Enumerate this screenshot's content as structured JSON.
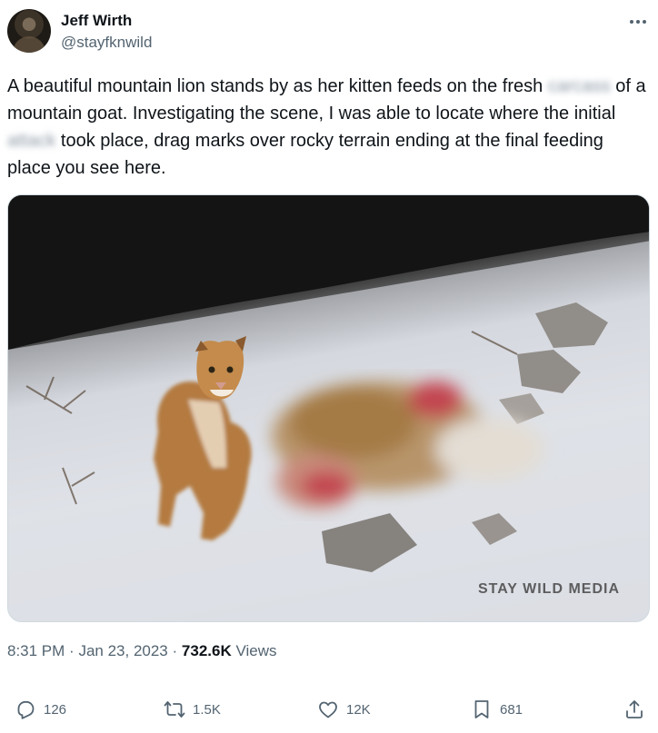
{
  "author": {
    "name": "Jeff Wirth",
    "handle": "@stayfknwild"
  },
  "tweet": {
    "segments": [
      {
        "text": "A beautiful mountain lion stands by as her kitten feeds on the fresh ",
        "blurred": false
      },
      {
        "text": "carcass",
        "blurred": true
      },
      {
        "text": " of a mountain goat. Investigating the scene, I was able to locate where the initial ",
        "blurred": false
      },
      {
        "text": "attack",
        "blurred": true
      },
      {
        "text": " took place, drag marks over rocky terrain ending at the final feeding place you see here.",
        "blurred": false
      }
    ]
  },
  "media": {
    "watermark": "STAY WILD MEDIA"
  },
  "meta": {
    "time": "8:31 PM",
    "separator": "·",
    "date": "Jan 23, 2023",
    "views_count": "732.6K",
    "views_label": "Views"
  },
  "actions": {
    "replies": "126",
    "reposts": "1.5K",
    "likes": "12K",
    "bookmarks": "681"
  },
  "icons": {
    "more": "more-icon",
    "reply": "reply-icon",
    "repost": "repost-icon",
    "like": "heart-icon",
    "bookmark": "bookmark-icon",
    "share": "share-icon"
  }
}
